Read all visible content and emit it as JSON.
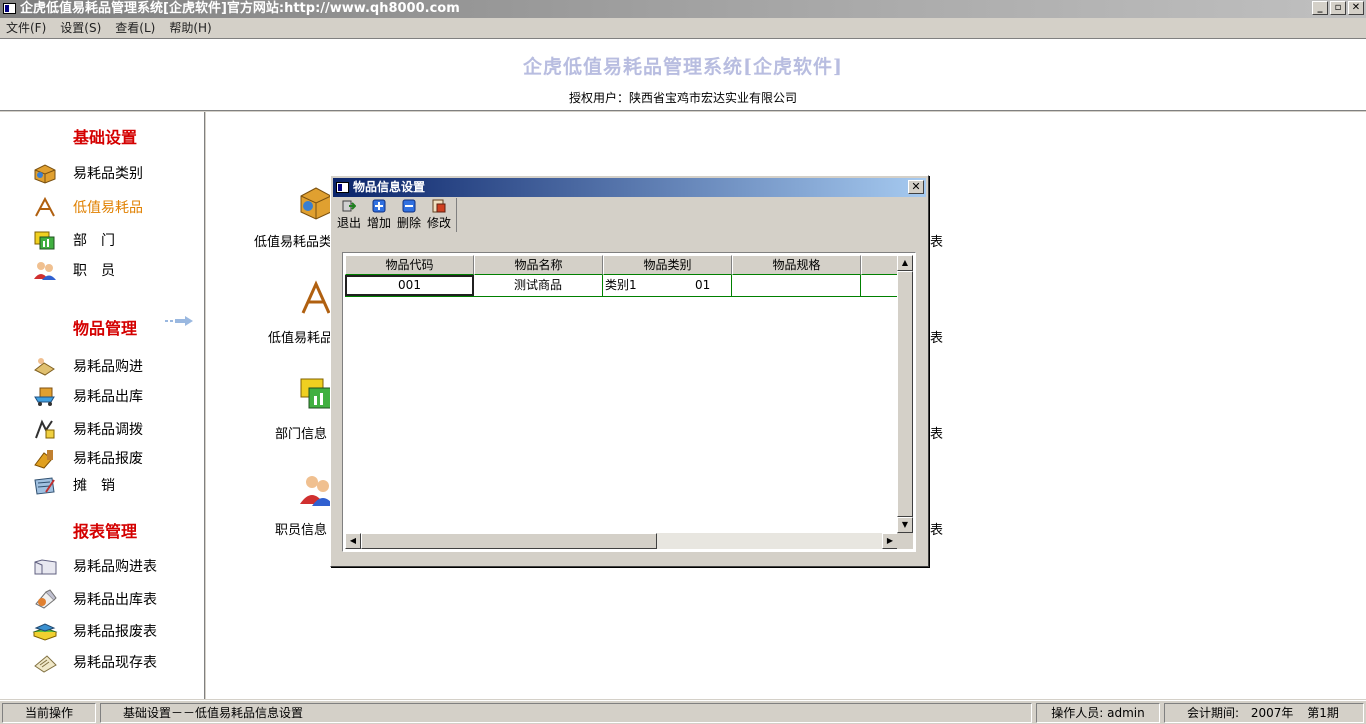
{
  "window": {
    "title": "企虎低值易耗品管理系统[企虎软件]官方网站:http://www.qh8000.com",
    "minimize": "_",
    "restore": "▫",
    "close": "✕"
  },
  "menu": [
    "文件(F)",
    "设置(S)",
    "查看(L)",
    "帮助(H)"
  ],
  "header": {
    "title": "企虎低值易耗品管理系统[企虎软件]",
    "user": "授权用户：陕西省宝鸡市宏达实业有限公司"
  },
  "sidebar": {
    "sections": [
      {
        "title": "基础设置",
        "items": [
          "易耗品类别",
          "低值易耗品",
          "部　门",
          "职　员"
        ]
      },
      {
        "title": "物品管理",
        "items": [
          "易耗品购进",
          "易耗品出库",
          "易耗品调拨",
          "易耗品报废",
          "摊　销"
        ]
      },
      {
        "title": "报表管理",
        "items": [
          "易耗品购进表",
          "易耗品出库表",
          "易耗品报废表",
          "易耗品现存表"
        ]
      }
    ]
  },
  "main": {
    "items": [
      "低值易耗品类",
      "低值易耗品",
      "部门信息",
      "职员信息"
    ],
    "right_labels": [
      "表",
      "表",
      "表",
      "表"
    ]
  },
  "dialog": {
    "title": "物品信息设置",
    "close": "✕",
    "toolbar": [
      "退出",
      "增加",
      "删除",
      "修改"
    ],
    "columns": [
      "物品代码",
      "物品名称",
      "物品类别",
      "物品规格",
      ""
    ],
    "rows": [
      [
        "001",
        "测试商品",
        "类别1",
        "01",
        "",
        ""
      ]
    ]
  },
  "status": {
    "label": "当前操作",
    "operation": "基础设置－－低值易耗品信息设置",
    "operator": "操作人员: admin",
    "period_label": "会计期间:",
    "year": "2007年",
    "period": "第1期"
  },
  "colors": {
    "accent": "#d40000",
    "active": "#e08000",
    "title_blue": "#0a246a",
    "header_title": "#b8bde0"
  }
}
